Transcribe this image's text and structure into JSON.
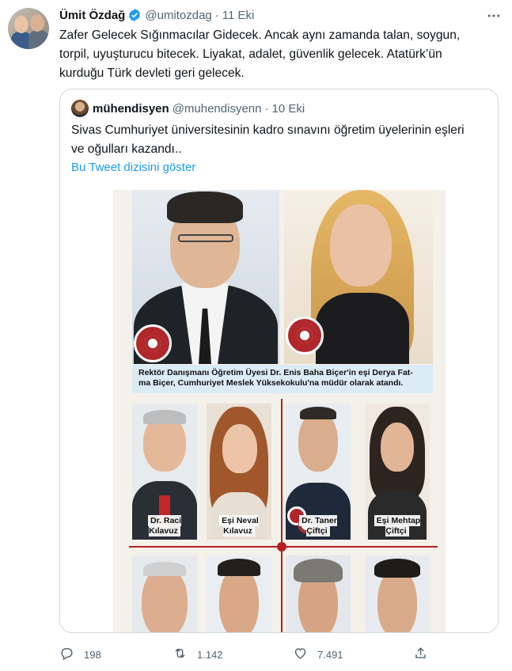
{
  "tweet": {
    "author_name": "Ümit Özdağ",
    "author_handle": "@umitozdag",
    "separator": "·",
    "date": "11 Eki",
    "text": "Zafer Gelecek Sığınmacılar Gidecek. Ancak aynı zamanda talan, soygun,\ntorpil, uyuşturucu bitecek. Liyakat, adalet, güvenlik gelecek. Atatürk’ün\nkurduğu Türk devleti geri gelecek."
  },
  "quote": {
    "author_name": "mühendisyen",
    "author_handle": "@muhendisyenn",
    "separator": "·",
    "date": "10 Eki",
    "text": "Sivas Cumhuriyet üniversitesinin kadro sınavını öğretim üyelerinin eşleri\nve oğulları kazandı..",
    "thread_link": "Bu Tweet dizisini göster",
    "image": {
      "caption": "Rektör Danışmanı Öğretim Üyesi Dr. Enis Baha Biçer'in eşi Derya Fat-\nma Biçer, Cumhuriyet Meslek Yüksekokulu'na müdür olarak atandı.",
      "labels": [
        "Dr. Raci\nKılavuz",
        "Eşi Neval\nKılavuz",
        "Dr. Taner\nÇiftçi",
        "Eşi Mehtap\nÇiftçi"
      ]
    }
  },
  "actions": {
    "replies": "198",
    "retweets": "1.142",
    "likes": "7.491"
  },
  "colors": {
    "link": "#1d9bf0",
    "secondary_text": "#536471",
    "border": "#cfd9de",
    "accent_red": "#b51f24"
  },
  "icons": [
    "verified-badge-icon",
    "more-icon",
    "reply-icon",
    "retweet-icon",
    "like-icon",
    "share-icon"
  ]
}
